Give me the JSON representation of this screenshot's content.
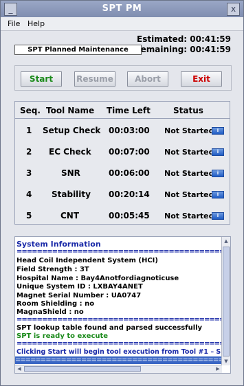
{
  "window": {
    "title": "SPT PM",
    "minimize_symbol": "_",
    "close_symbol": "x"
  },
  "menu": {
    "items": [
      {
        "label": "File"
      },
      {
        "label": "Help"
      }
    ]
  },
  "time": {
    "estimated_label": "Estimated:",
    "estimated_value": "00:41:59",
    "remaining_label": "Remaining:",
    "remaining_value": "00:41:59"
  },
  "panel_title": "SPT Planned Maintenance",
  "buttons": {
    "start": "Start",
    "resume": "Resume",
    "abort": "Abort",
    "exit": "Exit"
  },
  "table": {
    "headers": [
      "Seq.",
      "Tool Name",
      "Time Left",
      "Status"
    ],
    "rows": [
      {
        "seq": "1",
        "tool": "Setup Check",
        "time": "00:03:00",
        "status": "Not Started"
      },
      {
        "seq": "2",
        "tool": "EC Check",
        "time": "00:07:00",
        "status": "Not Started"
      },
      {
        "seq": "3",
        "tool": "SNR",
        "time": "00:06:00",
        "status": "Not Started"
      },
      {
        "seq": "4",
        "tool": "Stability",
        "time": "00:20:14",
        "status": "Not Started"
      },
      {
        "seq": "5",
        "tool": "CNT",
        "time": "00:05:45",
        "status": "Not Started"
      }
    ],
    "info_icon_symbol": "i"
  },
  "system_info": {
    "heading": "System Information",
    "separator": "================================================================",
    "lines": [
      "Head Coil Independent System (HCI)",
      "Field Strength : 3T",
      "Hospital Name : Bay4Anotfordiagnoticuse",
      "Unique System ID : LXBAY4ANET",
      "Magnet Serial Number : UA0747",
      "Room Shielding : no",
      "MagnaShield : no"
    ],
    "lookup_msg": "SPT lookup table found and parsed successfully",
    "ready_msg": "SPT is ready to execute",
    "clicking_msg": "Clicking Start will begin tool execution from Tool #1 – S"
  },
  "colors": {
    "start_text": "#1a8a1a",
    "disabled_text": "#9a9ea8",
    "exit_text": "#cc0000",
    "heading_blue": "#1a2aa8",
    "ready_green": "#1a8a1a"
  }
}
